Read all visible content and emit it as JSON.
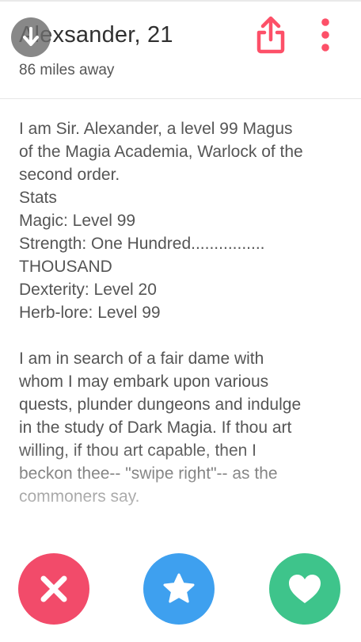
{
  "header": {
    "title": "Alexsander, 21",
    "distance": "86 miles away",
    "back_icon": "arrow-down-icon",
    "share_icon": "share-upload-icon",
    "more_icon": "more-vertical-icon"
  },
  "bio": {
    "lines": [
      "I am Sir. Alexander, a level 99 Magus",
      "of the Magia Academia, Warlock of the",
      "second order.",
      "Stats",
      "Magic: Level 99",
      "Strength: One Hundred................",
      "THOUSAND",
      "Dexterity: Level 20",
      "Herb-lore: Level 99",
      "",
      "I am in search of a fair dame with",
      "whom I may embark upon various",
      "quests, plunder dungeons and indulge",
      "in the study of Dark Magia. If thou art",
      "willing, if thou art capable, then I",
      "beckon thee-- \"swipe right\"-- as the",
      "commoners say."
    ]
  },
  "actions": {
    "nope_icon": "close-x-icon",
    "star_icon": "star-icon",
    "like_icon": "heart-icon"
  },
  "colors": {
    "accent": "#fd5068",
    "nope": "#f24b6a",
    "star": "#3ea0ef",
    "like": "#3ec48b"
  }
}
